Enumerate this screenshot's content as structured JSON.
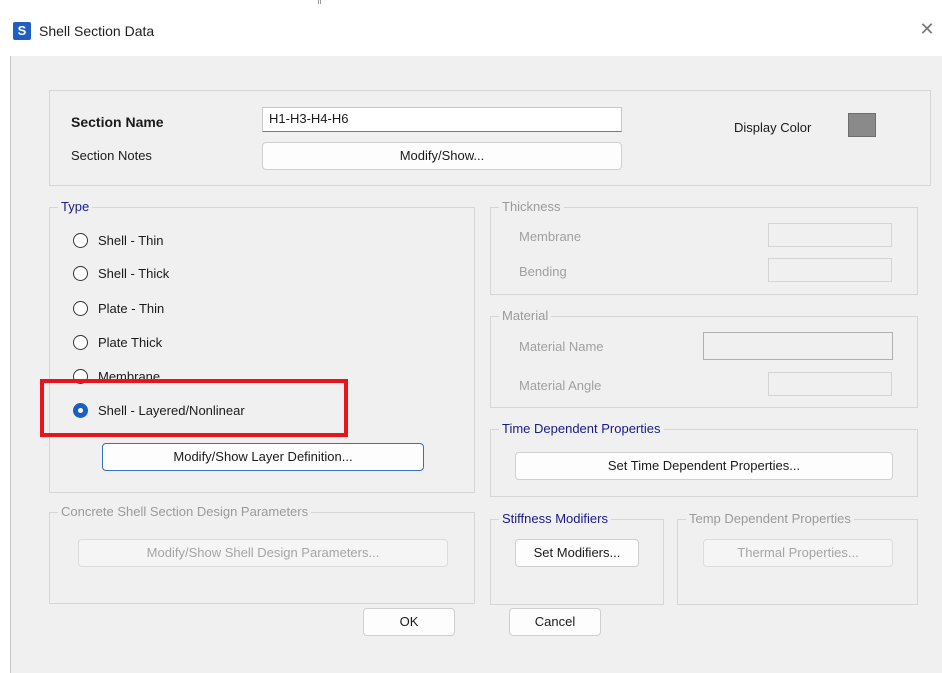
{
  "window": {
    "title": "Shell Section Data",
    "app_icon_letter": "S",
    "close_glyph": "✕"
  },
  "section": {
    "name_label": "Section Name",
    "name_value": "H1-H3-H4-H6",
    "notes_label": "Section Notes",
    "notes_button": "Modify/Show...",
    "display_color_label": "Display Color",
    "display_color": "#8a8a8a"
  },
  "type_group": {
    "title": "Type",
    "options": [
      {
        "label": "Shell - Thin",
        "checked": false
      },
      {
        "label": "Shell - Thick",
        "checked": false
      },
      {
        "label": "Plate - Thin",
        "checked": false
      },
      {
        "label": "Plate Thick",
        "checked": false
      },
      {
        "label": "Membrane",
        "checked": false
      },
      {
        "label": "Shell - Layered/Nonlinear",
        "checked": true
      }
    ],
    "layer_button": "Modify/Show Layer Definition..."
  },
  "concrete_group": {
    "title": "Concrete Shell Section Design Parameters",
    "button": "Modify/Show Shell Design Parameters..."
  },
  "thickness_group": {
    "title": "Thickness",
    "membrane_label": "Membrane",
    "bending_label": "Bending"
  },
  "material_group": {
    "title": "Material",
    "name_label": "Material Name",
    "angle_label": "Material Angle"
  },
  "time_group": {
    "title": "Time Dependent Properties",
    "button": "Set Time Dependent Properties..."
  },
  "stiffness_group": {
    "title": "Stiffness Modifiers",
    "button": "Set Modifiers..."
  },
  "temp_group": {
    "title": "Temp Dependent Properties",
    "button": "Thermal Properties..."
  },
  "footer": {
    "ok": "OK",
    "cancel": "Cancel"
  },
  "colors": {
    "accent": "#1a5fc4",
    "highlight": "#e8141c",
    "group_title_blue": "#1a1a8c"
  }
}
